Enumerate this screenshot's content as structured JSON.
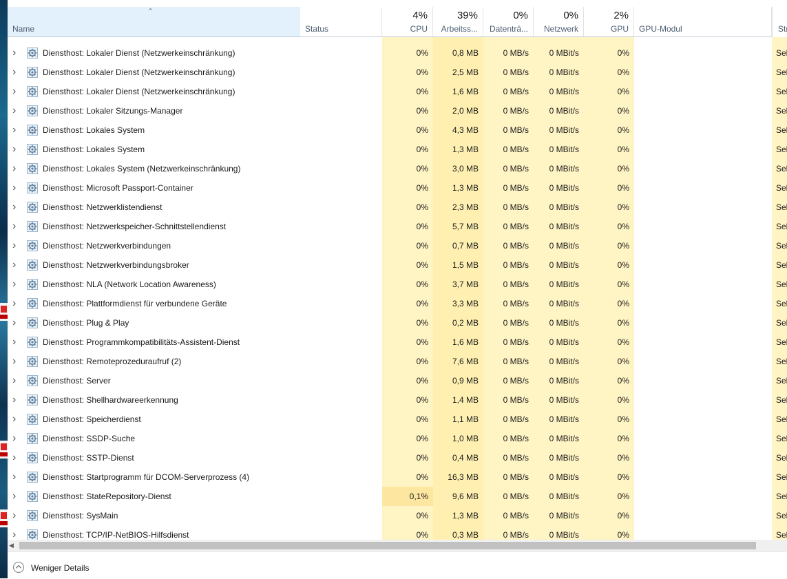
{
  "header": {
    "name_label": "Name",
    "status_label": "Status",
    "cpu_pct": "4%",
    "cpu_label": "CPU",
    "mem_pct": "39%",
    "mem_label": "Arbeitss...",
    "disk_pct": "0%",
    "disk_label": "Datenträ...",
    "net_pct": "0%",
    "net_label": "Netzwerk",
    "gpu_pct": "2%",
    "gpu_label": "GPU",
    "gpu_engine_label": "GPU-Modul",
    "power_label": "Str"
  },
  "rows": [
    {
      "name": "Diensthost: Lokaler Dienst (Netzwerkeinschränkung)",
      "cpu": "0%",
      "mem": "0,8 MB",
      "disk": "0 MB/s",
      "net": "0 MBit/s",
      "gpu": "0%",
      "power": "Seh"
    },
    {
      "name": "Diensthost: Lokaler Dienst (Netzwerkeinschränkung)",
      "cpu": "0%",
      "mem": "2,5 MB",
      "disk": "0 MB/s",
      "net": "0 MBit/s",
      "gpu": "0%",
      "power": "Seh"
    },
    {
      "name": "Diensthost: Lokaler Dienst (Netzwerkeinschränkung)",
      "cpu": "0%",
      "mem": "1,6 MB",
      "disk": "0 MB/s",
      "net": "0 MBit/s",
      "gpu": "0%",
      "power": "Seh"
    },
    {
      "name": "Diensthost: Lokaler Sitzungs-Manager",
      "cpu": "0%",
      "mem": "2,0 MB",
      "disk": "0 MB/s",
      "net": "0 MBit/s",
      "gpu": "0%",
      "power": "Seh"
    },
    {
      "name": "Diensthost: Lokales System",
      "cpu": "0%",
      "mem": "4,3 MB",
      "disk": "0 MB/s",
      "net": "0 MBit/s",
      "gpu": "0%",
      "power": "Seh"
    },
    {
      "name": "Diensthost: Lokales System",
      "cpu": "0%",
      "mem": "1,3 MB",
      "disk": "0 MB/s",
      "net": "0 MBit/s",
      "gpu": "0%",
      "power": "Seh"
    },
    {
      "name": "Diensthost: Lokales System (Netzwerkeinschränkung)",
      "cpu": "0%",
      "mem": "3,0 MB",
      "disk": "0 MB/s",
      "net": "0 MBit/s",
      "gpu": "0%",
      "power": "Seh"
    },
    {
      "name": "Diensthost: Microsoft Passport-Container",
      "cpu": "0%",
      "mem": "1,3 MB",
      "disk": "0 MB/s",
      "net": "0 MBit/s",
      "gpu": "0%",
      "power": "Seh"
    },
    {
      "name": "Diensthost: Netzwerklistendienst",
      "cpu": "0%",
      "mem": "2,3 MB",
      "disk": "0 MB/s",
      "net": "0 MBit/s",
      "gpu": "0%",
      "power": "Seh"
    },
    {
      "name": "Diensthost: Netzwerkspeicher-Schnittstellendienst",
      "cpu": "0%",
      "mem": "5,7 MB",
      "disk": "0 MB/s",
      "net": "0 MBit/s",
      "gpu": "0%",
      "power": "Seh"
    },
    {
      "name": "Diensthost: Netzwerkverbindungen",
      "cpu": "0%",
      "mem": "0,7 MB",
      "disk": "0 MB/s",
      "net": "0 MBit/s",
      "gpu": "0%",
      "power": "Seh"
    },
    {
      "name": "Diensthost: Netzwerkverbindungsbroker",
      "cpu": "0%",
      "mem": "1,5 MB",
      "disk": "0 MB/s",
      "net": "0 MBit/s",
      "gpu": "0%",
      "power": "Seh"
    },
    {
      "name": "Diensthost: NLA (Network Location Awareness)",
      "cpu": "0%",
      "mem": "3,7 MB",
      "disk": "0 MB/s",
      "net": "0 MBit/s",
      "gpu": "0%",
      "power": "Seh"
    },
    {
      "name": "Diensthost: Plattformdienst für verbundene Geräte",
      "cpu": "0%",
      "mem": "3,3 MB",
      "disk": "0 MB/s",
      "net": "0 MBit/s",
      "gpu": "0%",
      "power": "Seh"
    },
    {
      "name": "Diensthost: Plug & Play",
      "cpu": "0%",
      "mem": "0,2 MB",
      "disk": "0 MB/s",
      "net": "0 MBit/s",
      "gpu": "0%",
      "power": "Seh"
    },
    {
      "name": "Diensthost: Programmkompatibilitäts-Assistent-Dienst",
      "cpu": "0%",
      "mem": "1,6 MB",
      "disk": "0 MB/s",
      "net": "0 MBit/s",
      "gpu": "0%",
      "power": "Seh"
    },
    {
      "name": "Diensthost: Remoteprozeduraufruf (2)",
      "cpu": "0%",
      "mem": "7,6 MB",
      "disk": "0 MB/s",
      "net": "0 MBit/s",
      "gpu": "0%",
      "power": "Seh"
    },
    {
      "name": "Diensthost: Server",
      "cpu": "0%",
      "mem": "0,9 MB",
      "disk": "0 MB/s",
      "net": "0 MBit/s",
      "gpu": "0%",
      "power": "Seh"
    },
    {
      "name": "Diensthost: Shellhardwareerkennung",
      "cpu": "0%",
      "mem": "1,4 MB",
      "disk": "0 MB/s",
      "net": "0 MBit/s",
      "gpu": "0%",
      "power": "Seh"
    },
    {
      "name": "Diensthost: Speicherdienst",
      "cpu": "0%",
      "mem": "1,1 MB",
      "disk": "0 MB/s",
      "net": "0 MBit/s",
      "gpu": "0%",
      "power": "Seh"
    },
    {
      "name": "Diensthost: SSDP-Suche",
      "cpu": "0%",
      "mem": "1,0 MB",
      "disk": "0 MB/s",
      "net": "0 MBit/s",
      "gpu": "0%",
      "power": "Seh"
    },
    {
      "name": "Diensthost: SSTP-Dienst",
      "cpu": "0%",
      "mem": "0,4 MB",
      "disk": "0 MB/s",
      "net": "0 MBit/s",
      "gpu": "0%",
      "power": "Seh"
    },
    {
      "name": "Diensthost: Startprogramm für DCOM-Serverprozess (4)",
      "cpu": "0%",
      "mem": "16,3 MB",
      "disk": "0 MB/s",
      "net": "0 MBit/s",
      "gpu": "0%",
      "power": "Seh"
    },
    {
      "name": "Diensthost: StateRepository-Dienst",
      "cpu": "0,1%",
      "mem": "9,6 MB",
      "disk": "0 MB/s",
      "net": "0 MBit/s",
      "gpu": "0%",
      "power": "Seh"
    },
    {
      "name": "Diensthost: SysMain",
      "cpu": "0%",
      "mem": "1,3 MB",
      "disk": "0 MB/s",
      "net": "0 MBit/s",
      "gpu": "0%",
      "power": "Seh"
    },
    {
      "name": "Diensthost: TCP/IP-NetBIOS-Hilfsdienst",
      "cpu": "0%",
      "mem": "0,3 MB",
      "disk": "0 MB/s",
      "net": "0 MBit/s",
      "gpu": "0%",
      "power": "Seh"
    }
  ],
  "footer": {
    "fewer_details_label": "Weniger Details"
  },
  "colors": {
    "heat_light": "#fff4c4",
    "heat_mem": "#fff0b2",
    "heat_mid": "#fde7a0",
    "header_selected": "#e3f1fc"
  }
}
